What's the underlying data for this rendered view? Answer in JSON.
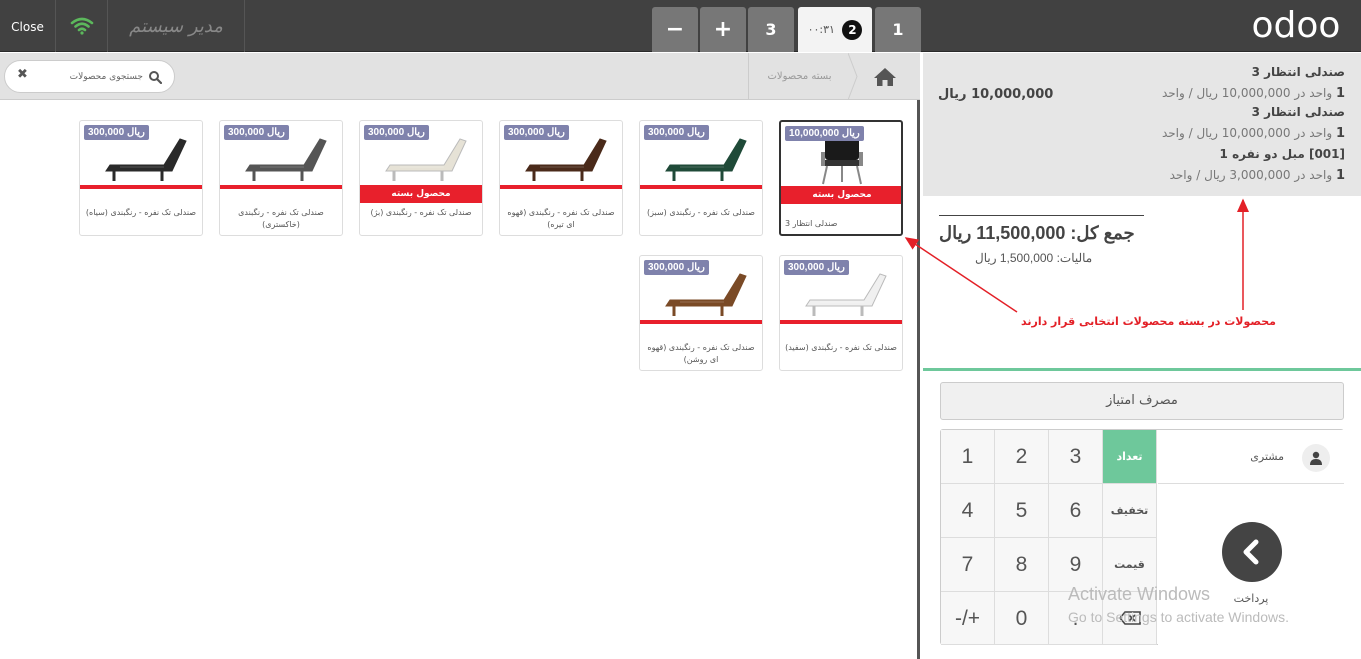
{
  "topbar": {
    "close_label": "Close",
    "cashier_name": "مدیر سیستم",
    "minus_label": "−",
    "plus_label": "+",
    "orders": [
      {
        "label": "3"
      },
      {
        "label": "2",
        "time": "۰۰:۳۱"
      },
      {
        "label": "1"
      }
    ],
    "logo_text": "odoo"
  },
  "breadcrumb": {
    "category": "بسته محصولات"
  },
  "search": {
    "placeholder": "جستجوی محصولات"
  },
  "products": [
    {
      "price": "10,000,000 ریال",
      "name": "صندلی انتظار 3",
      "pack_label": "محصول بسته",
      "color": "#1a1a1a",
      "selected": true
    },
    {
      "price": "300,000 ریال",
      "name": "صندلی تک نفره - رنگبندی (سبز)",
      "pack_label": "",
      "color": "#1f4a38"
    },
    {
      "price": "300,000 ریال",
      "name": "صندلی تک نفره - رنگبندی (قهوه ای تیره)",
      "pack_label": "",
      "color": "#4a2a1a"
    },
    {
      "price": "300,000 ریال",
      "name": "صندلی تک نفره - رنگبندی (بژ)",
      "pack_label": "محصول بسته",
      "color": "#e6e2d6"
    },
    {
      "price": "300,000 ریال",
      "name": "صندلی تک نفره - رنگبندی (خاکستری)",
      "pack_label": "",
      "color": "#555555"
    },
    {
      "price": "300,000 ریال",
      "name": "صندلی تک نفره - رنگبندی (سیاه)",
      "pack_label": "",
      "color": "#2a2a2a"
    },
    {
      "price": "300,000 ریال",
      "name": "صندلی تک نفره - رنگبندی (سفید)",
      "pack_label": "",
      "color": "#f0f0f0"
    },
    {
      "price": "300,000 ریال",
      "name": "صندلی تک نفره - رنگبندی (قهوه ای روشن)",
      "pack_label": "",
      "color": "#7a4a26"
    }
  ],
  "orderlines": [
    {
      "name": "صندلی انتظار 3",
      "qty": "1",
      "info": "واحد در 10,000,000 ریال / واحد",
      "price": "10,000,000 ریال"
    },
    {
      "name": "صندلی انتظار 3",
      "qty": "1",
      "info": "واحد در 10,000,000 ریال / واحد"
    },
    {
      "name": "[001] مبل دو نفره 1",
      "qty": "1",
      "info": "واحد در 3,000,000 ریال / واحد"
    }
  ],
  "summary": {
    "total": "جمع کل: 11,500,000 ریال",
    "tax": "مالیات: 1,500,000 ریال"
  },
  "points_button": "مصرف امتیاز",
  "keypad": {
    "keys": [
      "1",
      "2",
      "3",
      "4",
      "5",
      "6",
      "7",
      "8",
      "9",
      "-/+",
      "0",
      "."
    ],
    "modes": [
      "تعداد",
      "تخفیف",
      "قیمت"
    ],
    "customer": "مشتری",
    "pay": "پرداخت"
  },
  "annotation": "محصولات در بسته محصولات انتخابی قرار دارند",
  "watermark": {
    "title": "Activate Windows",
    "subtitle": "Go to Settings to activate Windows."
  }
}
